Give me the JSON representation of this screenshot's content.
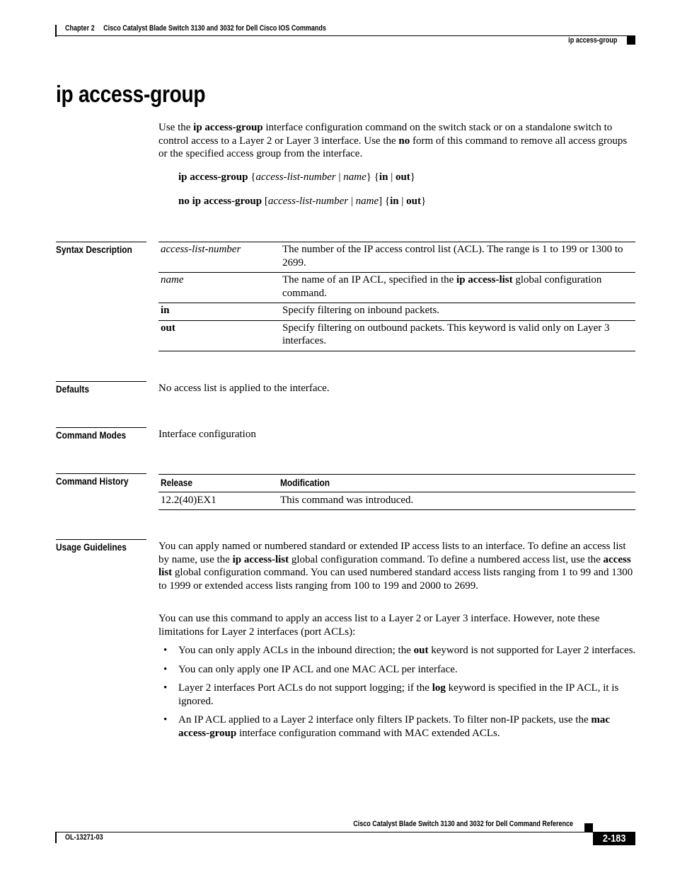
{
  "header": {
    "chapter": "Chapter 2",
    "chapter_title": "Cisco Catalyst Blade Switch 3130 and 3032 for Dell Cisco IOS Commands",
    "section": "ip access-group"
  },
  "title": "ip access-group",
  "intro": {
    "p1": "Use the ",
    "cmd": "ip access-group",
    "p2": " interface configuration command on the switch stack or on a standalone switch to control access to a Layer 2 or Layer 3 interface. Use the ",
    "no": "no",
    "p3": " form of this command to remove all access groups or the specified access group from the interface."
  },
  "syntax": [
    {
      "cmd": "ip access-group",
      "open1": " {",
      "arg1": "access-list-number",
      "sep1": " | ",
      "arg2": "name",
      "close1": "} {",
      "kw1": "in",
      "sep2": " | ",
      "kw2": "out",
      "close2": "}"
    },
    {
      "cmd": "no ip access-group",
      "open1": " [",
      "arg1": "access-list-number",
      "sep1": " | ",
      "arg2": "name",
      "close1": "] {",
      "kw1": "in",
      "sep2": " | ",
      "kw2": "out",
      "close2": "}"
    }
  ],
  "labels": {
    "syntax_description": "Syntax Description",
    "defaults": "Defaults",
    "command_modes": "Command Modes",
    "command_history": "Command History",
    "usage_guidelines": "Usage Guidelines"
  },
  "syntax_description": [
    {
      "term": "access-list-number",
      "desc_a": "The number of the IP access control list (ACL). The range is 1 to 199 or 1300 to 2699.",
      "desc_b": "",
      "desc_c": ""
    },
    {
      "term": "name",
      "desc_a": "The name of an IP ACL, specified in the ",
      "desc_b": "ip access-list",
      "desc_c": " global configuration command."
    },
    {
      "term": "in",
      "desc_a": "Specify filtering on inbound packets.",
      "desc_b": "",
      "desc_c": ""
    },
    {
      "term": "out",
      "desc_a": "Specify filtering on outbound packets. This keyword is valid only on Layer 3 interfaces.",
      "desc_b": "",
      "desc_c": ""
    }
  ],
  "defaults": "No access list is applied to the interface.",
  "command_modes": "Interface configuration",
  "command_history": {
    "headers": [
      "Release",
      "Modification"
    ],
    "rows": [
      {
        "release": "12.2(40)EX1",
        "modification": "This command was introduced."
      }
    ]
  },
  "usage": {
    "para1": {
      "a": "You can apply named or numbered standard or extended IP access lists to an interface. To define an access list by name, use the ",
      "b": "ip access-list",
      "c": " global configuration command. To define a numbered access list, use the ",
      "d": "access list",
      "e": " global configuration command. You can used numbered standard access lists ranging from 1 to 99 and 1300 to 1999 or extended access lists ranging from 100 to 199 and 2000 to 2699."
    },
    "para2": "You can use this command to apply an access list to a Layer 2 or Layer 3 interface. However, note these limitations for Layer 2 interfaces (port ACLs):",
    "bullets": [
      {
        "a": "You can only apply ACLs in the inbound direction; the ",
        "b": "out",
        "c": " keyword is not supported for Layer 2 interfaces."
      },
      {
        "a": "You can only apply one IP ACL and one MAC ACL per interface.",
        "b": "",
        "c": ""
      },
      {
        "a": "Layer 2 interfaces Port ACLs do not support logging; if the ",
        "b": "log",
        "c": " keyword is specified in the IP ACL, it is ignored."
      },
      {
        "a": "An IP ACL applied to a Layer 2 interface only filters IP packets. To filter non-IP packets, use the ",
        "b": "mac access-group",
        "c": " interface configuration command with MAC extended ACLs."
      }
    ],
    "bullet_glyph": "•"
  },
  "footer": {
    "book_title": "Cisco Catalyst Blade Switch 3130 and 3032 for Dell Command Reference",
    "doc_number": "OL-13271-03",
    "page_number": "2-183"
  }
}
